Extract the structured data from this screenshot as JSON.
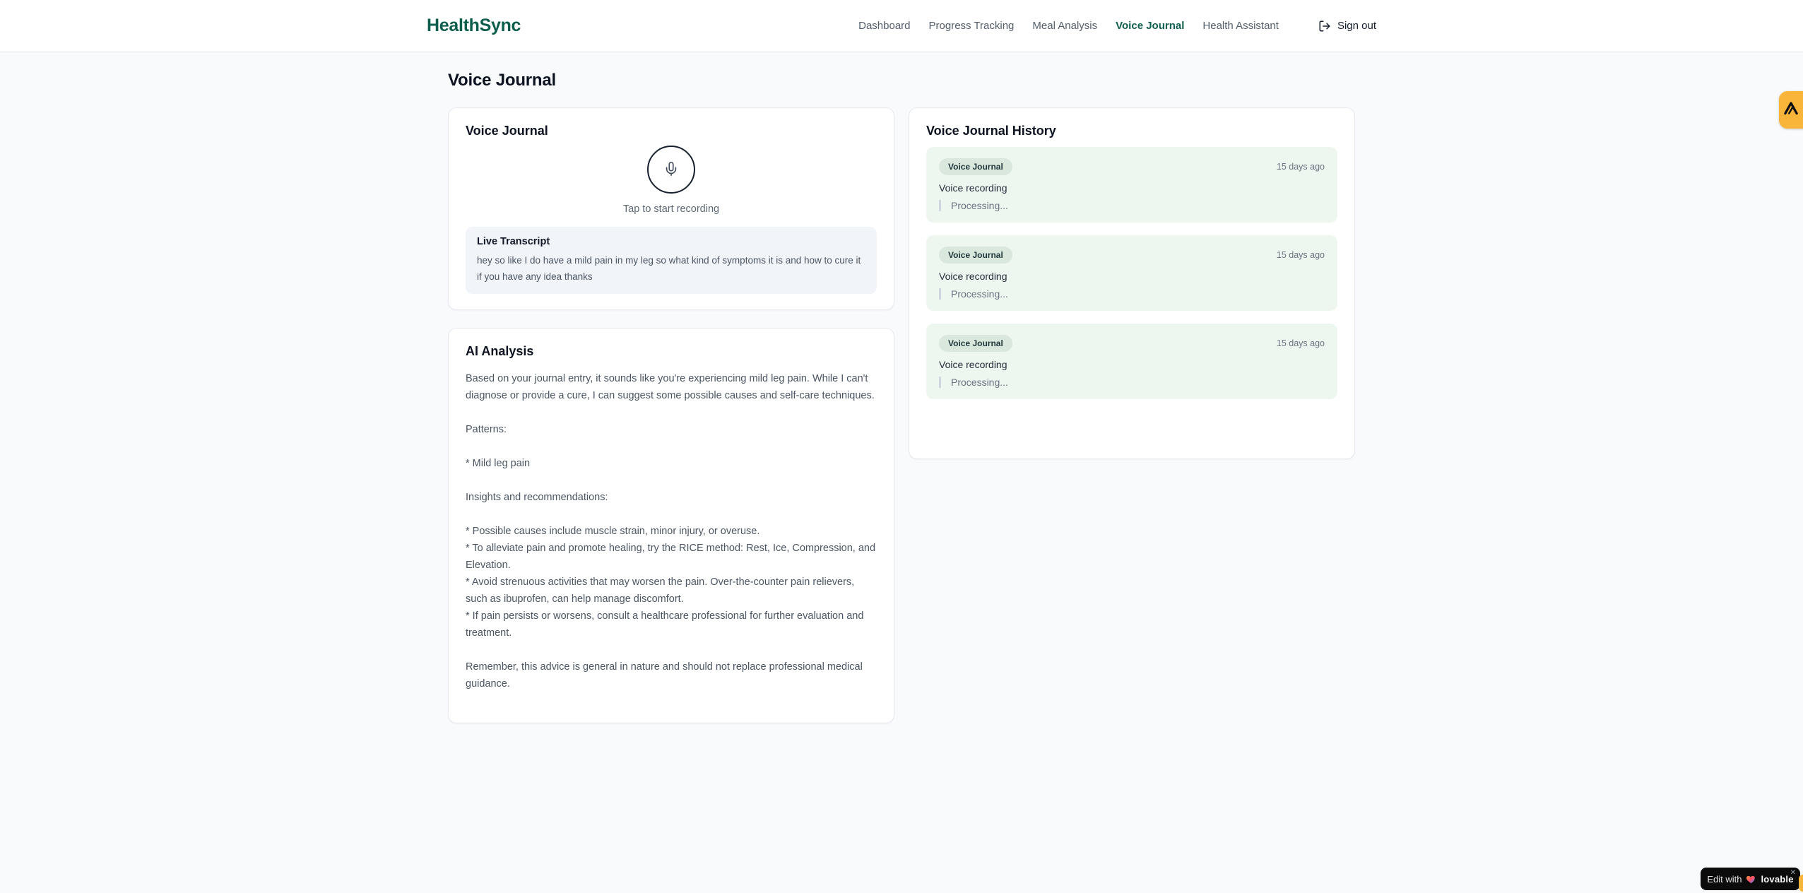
{
  "brand": "HealthSync",
  "nav": {
    "items": [
      {
        "label": "Dashboard",
        "active": false
      },
      {
        "label": "Progress Tracking",
        "active": false
      },
      {
        "label": "Meal Analysis",
        "active": false
      },
      {
        "label": "Voice Journal",
        "active": true
      },
      {
        "label": "Health Assistant",
        "active": false
      }
    ],
    "sign_out": "Sign out"
  },
  "page_title": "Voice Journal",
  "recorder": {
    "card_title": "Voice Journal",
    "mic_icon": "microphone-icon",
    "tap_hint": "Tap to start recording",
    "transcript_title": "Live Transcript",
    "transcript_text": "hey so like I do have a mild pain in my leg so what kind of symptoms it is and how to cure it if you have any idea thanks"
  },
  "analysis": {
    "card_title": "AI Analysis",
    "blocks": [
      "Based on your journal entry, it sounds like you're experiencing mild leg pain. While I can't diagnose or provide a cure, I can suggest some possible causes and self-care techniques.",
      "Patterns:",
      "* Mild leg pain",
      "Insights and recommendations:",
      "* Possible causes include muscle strain, minor injury, or overuse.\n* To alleviate pain and promote healing, try the RICE method: Rest, Ice, Compression, and Elevation.\n* Avoid strenuous activities that may worsen the pain. Over-the-counter pain relievers, such as ibuprofen, can help manage discomfort.\n* If pain persists or worsens, consult a healthcare professional for further evaluation and treatment.",
      "Remember, this advice is general in nature and should not replace professional medical guidance."
    ]
  },
  "history": {
    "card_title": "Voice Journal History",
    "entries": [
      {
        "badge": "Voice Journal",
        "time": "15 days ago",
        "title": "Voice recording",
        "status": "Processing..."
      },
      {
        "badge": "Voice Journal",
        "time": "15 days ago",
        "title": "Voice recording",
        "status": "Processing..."
      },
      {
        "badge": "Voice Journal",
        "time": "15 days ago",
        "title": "Voice recording",
        "status": "Processing..."
      }
    ]
  },
  "widgets": {
    "edit_prefix": "Edit with",
    "edit_brand": "lovable",
    "close": "✕"
  },
  "colors": {
    "brand_green": "#0b5d4c",
    "nav_active": "#0f5f50",
    "amber": "#f9b53a",
    "entry_bg": "#eef6f0",
    "badge_bg": "#d9e7dc"
  }
}
